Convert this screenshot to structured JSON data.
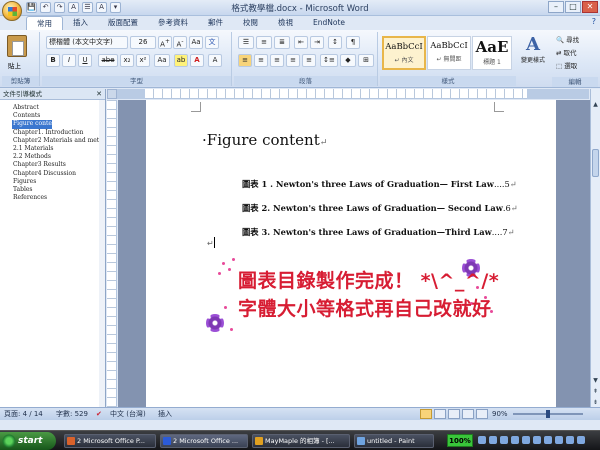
{
  "window": {
    "title": "格式教學檔.docx - Microsoft Word",
    "controls": [
      "–",
      "□",
      "✕"
    ]
  },
  "quick_access": [
    "💾",
    "↶",
    "↷",
    "A",
    "☰",
    "A",
    "▾"
  ],
  "tabs": [
    "常用",
    "插入",
    "版面配置",
    "參考資料",
    "郵件",
    "校閱",
    "檢視",
    "EndNote"
  ],
  "ribbon": {
    "clipboard": {
      "label": "剪貼簿",
      "paste": "貼上"
    },
    "font": {
      "label": "字型",
      "font_name": "標楷體 (本文中文字)",
      "font_size": "26",
      "buttons": [
        "B",
        "I",
        "U",
        "abe",
        "x₂",
        "x²",
        "Aa",
        "A"
      ]
    },
    "paragraph": {
      "label": "段落"
    },
    "styles": {
      "label": "樣式",
      "items": [
        {
          "sample": "AaBbCcI",
          "name": "↵ 內文"
        },
        {
          "sample": "AaBbCcI",
          "name": "↵ 無間距"
        },
        {
          "sample": "AaE",
          "name": "標題 1"
        }
      ],
      "change_styles": "變更樣式"
    },
    "editing": {
      "label": "編輯",
      "find": "尋找",
      "replace": "取代",
      "select": "選取"
    }
  },
  "nav_pane": {
    "title": "文件引導模式",
    "items": [
      "Abstract",
      "Contents",
      "Figure content",
      "Chapter1. Introduction",
      "Chapter2 Materials and methods",
      "2.1 Materials",
      "2.2 Methods",
      "Chapter3 Results",
      "Chapter4 Discussion",
      "Figures",
      "Tables",
      "References"
    ],
    "selected_index": 2
  },
  "document": {
    "heading": "Figure content",
    "figure_lines": [
      {
        "prefix": "圖表 ",
        "text": "1 . Newton's three Laws of Graduation— First Law",
        "leader": "....",
        "page": "5"
      },
      {
        "prefix": "圖表 ",
        "text": "2. Newton's three Laws of Graduation— Second Law",
        "leader": ".",
        "page": "6"
      },
      {
        "prefix": "圖表 ",
        "text": "3. Newton's three Laws of Graduation—Third Law",
        "leader": "....",
        "page": "7"
      }
    ],
    "overlay_line1": "圖表目錄製作完成！ *\\^_^/*",
    "overlay_line2": "字體大小等格式再自己改就好"
  },
  "statusbar": {
    "page": "頁面: 4 / 14",
    "words": "字數: 529",
    "language": "中文 (台灣)",
    "mode": "插入",
    "zoom": "90%"
  },
  "taskbar": {
    "start": "start",
    "tasks": [
      {
        "label": "2 Microsoft Office P...",
        "color": "#d9622b"
      },
      {
        "label": "2 Microsoft Office ...",
        "color": "#2b5bd9"
      },
      {
        "label": "MayMaple 的相簿 - [...",
        "color": "#e0a020"
      },
      {
        "label": "untitled - Paint",
        "color": "#6fa4e0"
      }
    ],
    "battery": "100%"
  }
}
